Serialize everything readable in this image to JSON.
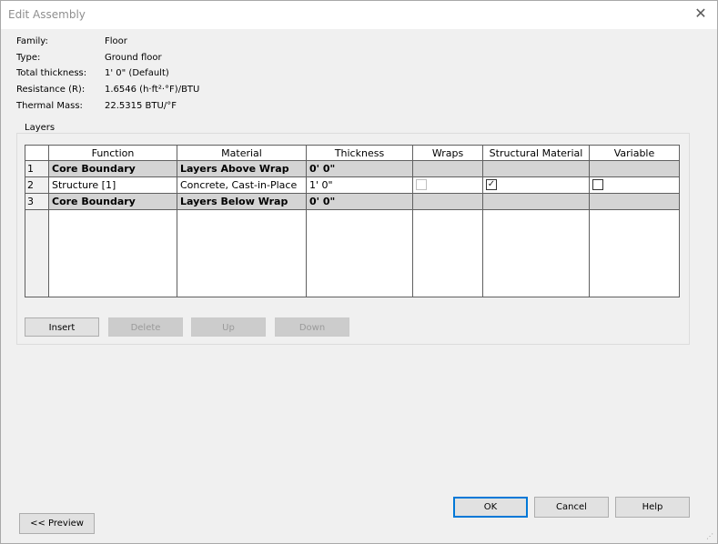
{
  "window": {
    "title": "Edit Assembly",
    "close_icon": "close-icon"
  },
  "properties": [
    {
      "label": "Family:",
      "value": "Floor"
    },
    {
      "label": "Type:",
      "value": "Ground floor"
    },
    {
      "label": "Total thickness:",
      "value": "1'  0\" (Default)"
    },
    {
      "label": "Resistance (R):",
      "value": "1.6546 (h·ft²·°F)/BTU"
    },
    {
      "label": "Thermal Mass:",
      "value": "22.5315 BTU/°F"
    }
  ],
  "layers": {
    "group_label": "Layers",
    "columns": [
      "Function",
      "Material",
      "Thickness",
      "Wraps",
      "Structural Material",
      "Variable"
    ],
    "rows": [
      {
        "num": "1",
        "function": "Core Boundary",
        "material": "Layers Above Wrap",
        "thickness": "0'  0\"",
        "type": "boundary"
      },
      {
        "num": "2",
        "function": "Structure [1]",
        "material": "Concrete, Cast-in-Place",
        "thickness": "1'  0\"",
        "wraps": false,
        "structural": true,
        "variable": false,
        "type": "layer"
      },
      {
        "num": "3",
        "function": "Core Boundary",
        "material": "Layers Below Wrap",
        "thickness": "0'  0\"",
        "type": "boundary"
      }
    ]
  },
  "buttons": {
    "insert": "Insert",
    "delete": "Delete",
    "up": "Up",
    "down": "Down",
    "ok": "OK",
    "cancel": "Cancel",
    "help": "Help",
    "preview": "<< Preview"
  },
  "colors": {
    "accent": "#0078d7",
    "boundary_row": "#d4d4d4"
  }
}
